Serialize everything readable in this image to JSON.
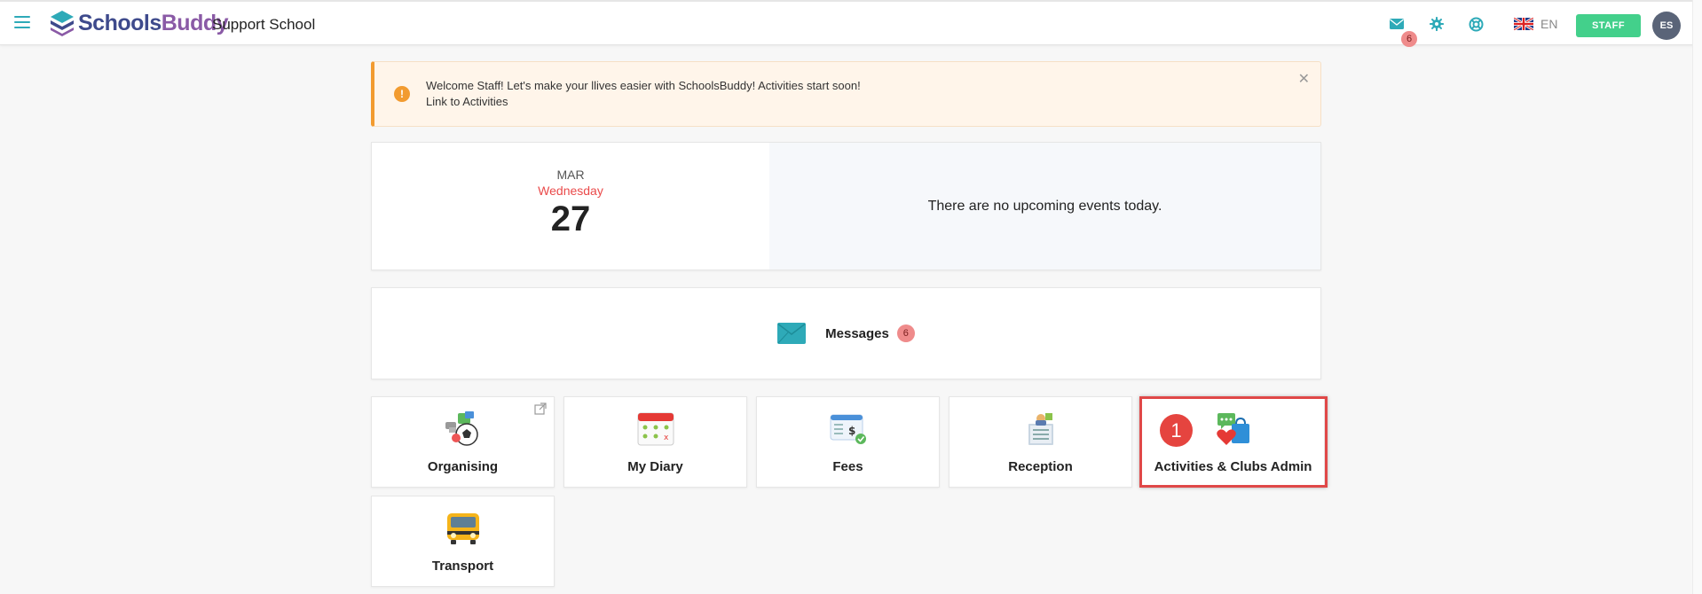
{
  "app": {
    "logo_part1": "Schools",
    "logo_part2": "Buddy",
    "school_name": "Support School"
  },
  "topbar": {
    "mail_badge": "6",
    "language": "EN",
    "role_button": "STAFF",
    "avatar_initials": "ES"
  },
  "alert": {
    "line1": "Welcome Staff!  Let's make your llives easier with SchoolsBuddy!  Activities start soon!",
    "line2": "Link to Activities",
    "close": "✕"
  },
  "date": {
    "month": "MAR",
    "weekday": "Wednesday",
    "day": "27",
    "events_text": "There are no upcoming events today."
  },
  "messages": {
    "label": "Messages",
    "count": "6"
  },
  "tiles": [
    {
      "label": "Organising"
    },
    {
      "label": "My Diary"
    },
    {
      "label": "Fees"
    },
    {
      "label": "Reception"
    },
    {
      "label": "Activities & Clubs Admin"
    },
    {
      "label": "Transport"
    }
  ],
  "annotation": {
    "step": "1"
  },
  "colors": {
    "accent": "#2eaab8",
    "staff_button": "#43d08b",
    "alert_border": "#f29b30",
    "highlight": "#e04848",
    "weekday": "#ea4a4a"
  }
}
